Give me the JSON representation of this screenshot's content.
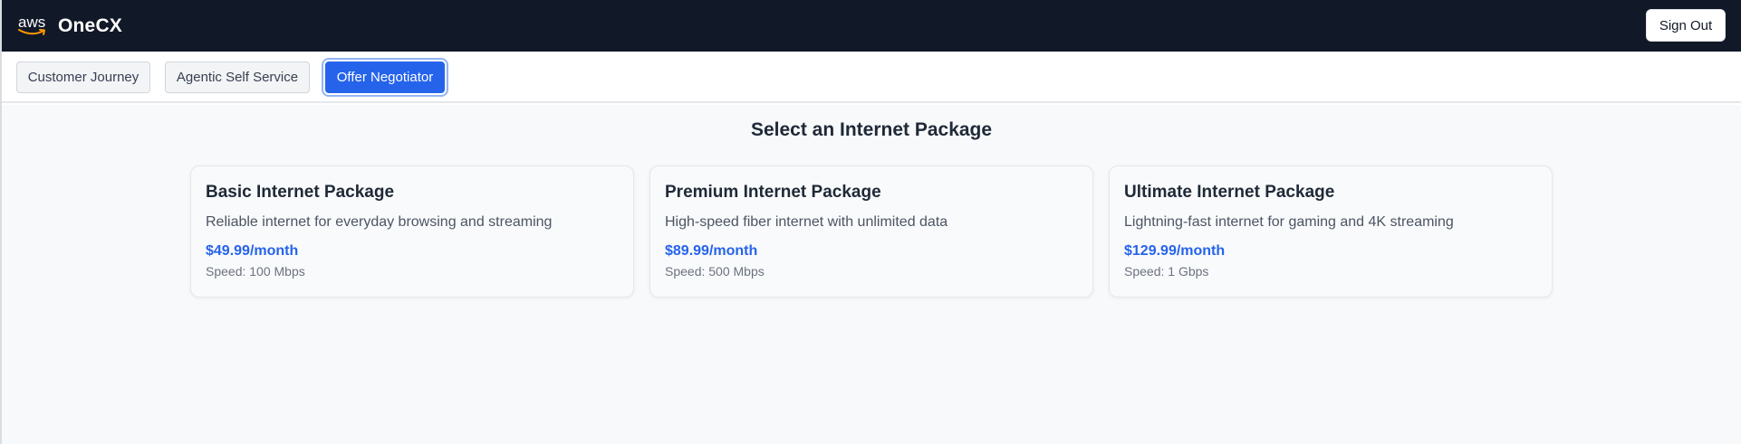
{
  "header": {
    "logo_text": "aws",
    "app_title": "OneCX",
    "signout_label": "Sign Out"
  },
  "tabs": [
    {
      "label": "Customer Journey",
      "active": false
    },
    {
      "label": "Agentic Self Service",
      "active": false
    },
    {
      "label": "Offer Negotiator",
      "active": true
    }
  ],
  "main": {
    "heading": "Select an Internet Package",
    "packages": [
      {
        "title": "Basic Internet Package",
        "description": "Reliable internet for everyday browsing and streaming",
        "price": "$49.99/month",
        "speed": "Speed: 100 Mbps"
      },
      {
        "title": "Premium Internet Package",
        "description": "High-speed fiber internet with unlimited data",
        "price": "$89.99/month",
        "speed": "Speed: 500 Mbps"
      },
      {
        "title": "Ultimate Internet Package",
        "description": "Lightning-fast internet for gaming and 4K streaming",
        "price": "$129.99/month",
        "speed": "Speed: 1 Gbps"
      }
    ]
  },
  "colors": {
    "header_bg": "#111827",
    "accent": "#2563eb",
    "logo_smile": "#ff9900",
    "page_bg": "#f8f9fb"
  }
}
